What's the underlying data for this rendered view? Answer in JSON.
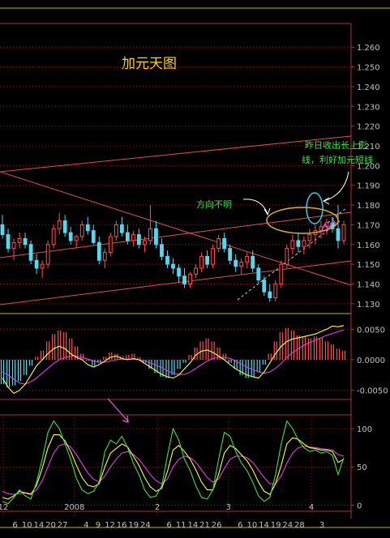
{
  "chart_data": [
    {
      "type": "candlestick",
      "title": "加元天图",
      "y_ticks": [
        "1.260",
        "1.250",
        "1.240",
        "1.230",
        "1.220",
        "1.210",
        "1.200",
        "1.190",
        "1.180",
        "1.170",
        "1.160",
        "1.150",
        "1.140",
        "1.130"
      ],
      "ylim": [
        1.125,
        1.272
      ],
      "annotations": [
        "方向不明",
        "昨日收出长上影",
        "线，利好加元短线"
      ],
      "candles": [
        [
          1.17,
          1.175,
          1.163,
          1.165
        ],
        [
          1.165,
          1.168,
          1.156,
          1.158
        ],
        [
          1.158,
          1.163,
          1.152,
          1.161
        ],
        [
          1.161,
          1.166,
          1.158,
          1.163
        ],
        [
          1.163,
          1.166,
          1.158,
          1.16
        ],
        [
          1.16,
          1.162,
          1.15,
          1.152
        ],
        [
          1.152,
          1.155,
          1.145,
          1.148
        ],
        [
          1.148,
          1.152,
          1.143,
          1.15
        ],
        [
          1.15,
          1.162,
          1.148,
          1.16
        ],
        [
          1.16,
          1.17,
          1.158,
          1.168
        ],
        [
          1.168,
          1.176,
          1.165,
          1.172
        ],
        [
          1.172,
          1.175,
          1.164,
          1.166
        ],
        [
          1.166,
          1.169,
          1.16,
          1.162
        ],
        [
          1.162,
          1.165,
          1.158,
          1.164
        ],
        [
          1.164,
          1.172,
          1.162,
          1.17
        ],
        [
          1.17,
          1.174,
          1.165,
          1.167
        ],
        [
          1.167,
          1.17,
          1.16,
          1.161
        ],
        [
          1.161,
          1.164,
          1.15,
          1.152
        ],
        [
          1.152,
          1.158,
          1.148,
          1.156
        ],
        [
          1.156,
          1.166,
          1.154,
          1.164
        ],
        [
          1.164,
          1.172,
          1.162,
          1.17
        ],
        [
          1.17,
          1.174,
          1.164,
          1.166
        ],
        [
          1.166,
          1.17,
          1.16,
          1.162
        ],
        [
          1.162,
          1.167,
          1.159,
          1.165
        ],
        [
          1.165,
          1.168,
          1.158,
          1.16
        ],
        [
          1.16,
          1.164,
          1.156,
          1.162
        ],
        [
          1.162,
          1.18,
          1.16,
          1.168
        ],
        [
          1.168,
          1.172,
          1.158,
          1.16
        ],
        [
          1.16,
          1.163,
          1.152,
          1.154
        ],
        [
          1.154,
          1.157,
          1.148,
          1.15
        ],
        [
          1.15,
          1.153,
          1.145,
          1.148
        ],
        [
          1.148,
          1.15,
          1.141,
          1.144
        ],
        [
          1.144,
          1.148,
          1.138,
          1.14
        ],
        [
          1.14,
          1.146,
          1.138,
          1.145
        ],
        [
          1.145,
          1.15,
          1.143,
          1.148
        ],
        [
          1.148,
          1.156,
          1.146,
          1.154
        ],
        [
          1.154,
          1.157,
          1.148,
          1.15
        ],
        [
          1.15,
          1.16,
          1.148,
          1.158
        ],
        [
          1.158,
          1.165,
          1.156,
          1.163
        ],
        [
          1.163,
          1.166,
          1.156,
          1.158
        ],
        [
          1.158,
          1.16,
          1.15,
          1.152
        ],
        [
          1.152,
          1.155,
          1.146,
          1.149
        ],
        [
          1.149,
          1.153,
          1.145,
          1.151
        ],
        [
          1.151,
          1.156,
          1.148,
          1.154
        ],
        [
          1.154,
          1.157,
          1.146,
          1.148
        ],
        [
          1.148,
          1.15,
          1.14,
          1.142
        ],
        [
          1.142,
          1.144,
          1.134,
          1.136
        ],
        [
          1.136,
          1.14,
          1.131,
          1.133
        ],
        [
          1.133,
          1.142,
          1.131,
          1.14
        ],
        [
          1.14,
          1.152,
          1.138,
          1.15
        ],
        [
          1.15,
          1.16,
          1.148,
          1.158
        ],
        [
          1.158,
          1.165,
          1.155,
          1.162
        ],
        [
          1.162,
          1.166,
          1.156,
          1.159
        ],
        [
          1.159,
          1.164,
          1.155,
          1.162
        ],
        [
          1.162,
          1.168,
          1.158,
          1.165
        ],
        [
          1.165,
          1.17,
          1.16,
          1.167
        ],
        [
          1.167,
          1.172,
          1.163,
          1.169
        ],
        [
          1.169,
          1.173,
          1.165,
          1.171
        ],
        [
          1.171,
          1.174,
          1.166,
          1.168
        ],
        [
          1.168,
          1.18,
          1.158,
          1.162
        ],
        [
          1.162,
          1.172,
          1.16,
          1.17
        ]
      ]
    },
    {
      "type": "bar+line",
      "title": "MACD",
      "y_ticks": [
        "0.0050",
        "0.0000",
        "-0.0050"
      ],
      "ylim": [
        -0.0065,
        0.0065
      ],
      "hist": [
        -0.004,
        -0.0045,
        -0.0042,
        -0.0035,
        -0.0025,
        -0.001,
        0.0005,
        0.0015,
        0.003,
        0.0042,
        0.0048,
        0.0045,
        0.0035,
        0.0022,
        0.001,
        -0.0002,
        -0.001,
        -0.0005,
        0.0005,
        0.0012,
        0.001,
        0.0006,
        0.0008,
        0.001,
        0.0004,
        -0.0005,
        -0.0015,
        -0.0022,
        -0.0028,
        -0.003,
        -0.0025,
        -0.0015,
        -0.0005,
        0.0008,
        0.002,
        0.003,
        0.0035,
        0.003,
        0.002,
        0.001,
        -0.0005,
        -0.0015,
        -0.0025,
        -0.003,
        -0.0028,
        -0.002,
        -0.0008,
        0.001,
        0.003,
        0.0045,
        0.0052,
        0.0048,
        0.004,
        0.0038,
        0.0035,
        0.0038,
        0.0036,
        0.003,
        0.0025,
        0.0018,
        0.0015
      ],
      "dif": [
        -0.003,
        -0.0045,
        -0.0055,
        -0.005,
        -0.004,
        -0.0025,
        -0.001,
        0.0,
        0.001,
        0.0018,
        0.0022,
        0.0018,
        0.001,
        0.0004,
        0.0,
        -0.0008,
        -0.0012,
        -0.0008,
        -0.0002,
        0.0004,
        0.0006,
        0.0002,
        0.0,
        0.0002,
        0.0,
        -0.0006,
        -0.0012,
        -0.0018,
        -0.0024,
        -0.0028,
        -0.003,
        -0.0025,
        -0.0015,
        -0.0005,
        0.0008,
        0.0014,
        0.0016,
        0.0012,
        0.0006,
        0.0,
        -0.0008,
        -0.0015,
        -0.002,
        -0.0025,
        -0.0028,
        -0.003,
        -0.002,
        -0.0005,
        0.001,
        0.0022,
        0.003,
        0.0034,
        0.0036,
        0.0038,
        0.004,
        0.0042,
        0.0046,
        0.005,
        0.0055,
        0.0054,
        0.0056
      ],
      "dea": [
        -0.002,
        -0.0025,
        -0.0032,
        -0.0038,
        -0.004,
        -0.0036,
        -0.003,
        -0.0022,
        -0.0014,
        -0.0006,
        0.0,
        0.0004,
        0.0006,
        0.0006,
        0.0004,
        0.0001,
        -0.0002,
        -0.0004,
        -0.0004,
        -0.0002,
        0.0,
        0.0001,
        0.0001,
        0.0001,
        0.0,
        -0.0002,
        -0.0005,
        -0.0009,
        -0.0013,
        -0.0018,
        -0.0022,
        -0.0024,
        -0.0024,
        -0.002,
        -0.0014,
        -0.0008,
        -0.0002,
        0.0002,
        0.0004,
        0.0004,
        0.0002,
        -0.0002,
        -0.0007,
        -0.0012,
        -0.0016,
        -0.002,
        -0.0022,
        -0.002,
        -0.0014,
        -0.0006,
        0.0004,
        0.0012,
        0.0018,
        0.0024,
        0.0028,
        0.0032,
        0.0036,
        0.004,
        0.0043,
        0.0046,
        0.0049
      ]
    },
    {
      "type": "line",
      "title": "KDJ",
      "y_ticks": [
        "100",
        "50",
        "0"
      ],
      "ylim": [
        -8,
        118
      ],
      "x_labels": [
        "12",
        "6",
        "10",
        "14",
        "20",
        "27",
        "2008",
        "4",
        "9",
        "12",
        "16",
        "19",
        "24",
        "2",
        "6",
        "11",
        "14",
        "21",
        "26",
        "3",
        "6",
        "10",
        "14",
        "19",
        "24",
        "28",
        "4",
        "3"
      ],
      "j": [
        5,
        2,
        10,
        20,
        12,
        8,
        30,
        60,
        95,
        110,
        100,
        80,
        60,
        35,
        20,
        15,
        18,
        30,
        70,
        85,
        80,
        90,
        75,
        55,
        40,
        20,
        10,
        12,
        25,
        65,
        100,
        85,
        60,
        45,
        25,
        10,
        8,
        20,
        60,
        95,
        90,
        70,
        55,
        45,
        30,
        12,
        5,
        10,
        40,
        80,
        110,
        100,
        85,
        75,
        70,
        72,
        68,
        70,
        65,
        40,
        62
      ],
      "k": [
        10,
        8,
        12,
        18,
        16,
        14,
        26,
        48,
        75,
        92,
        92,
        84,
        70,
        52,
        36,
        26,
        24,
        28,
        50,
        68,
        74,
        80,
        76,
        64,
        52,
        36,
        24,
        18,
        22,
        44,
        72,
        78,
        70,
        60,
        46,
        30,
        20,
        20,
        40,
        68,
        78,
        74,
        66,
        58,
        46,
        30,
        18,
        14,
        28,
        52,
        80,
        88,
        86,
        80,
        75,
        74,
        72,
        72,
        70,
        56,
        60
      ],
      "d": [
        18,
        15,
        14,
        15,
        16,
        15,
        20,
        32,
        50,
        68,
        78,
        80,
        76,
        66,
        54,
        42,
        34,
        30,
        38,
        50,
        60,
        68,
        70,
        66,
        60,
        50,
        40,
        32,
        28,
        34,
        50,
        60,
        64,
        62,
        56,
        46,
        36,
        30,
        34,
        48,
        60,
        64,
        64,
        62,
        56,
        46,
        36,
        28,
        28,
        38,
        55,
        68,
        75,
        77,
        76,
        75,
        74,
        73,
        72,
        66,
        64
      ]
    }
  ]
}
